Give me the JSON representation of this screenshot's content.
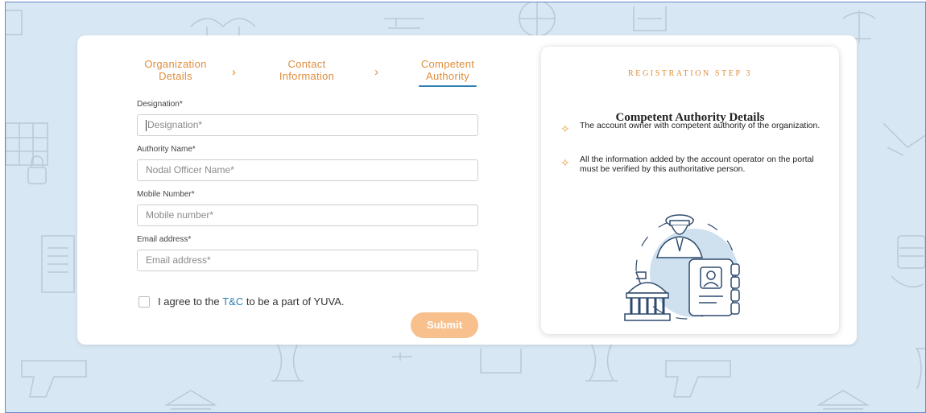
{
  "stepper": {
    "steps": [
      {
        "label_line1": "Organization",
        "label_line2": "Details"
      },
      {
        "label_line1": "Contact",
        "label_line2": "Information"
      },
      {
        "label_line1": "Competent",
        "label_line2": "Authority"
      }
    ],
    "chevron": "›",
    "active_step": 3
  },
  "form": {
    "designation": {
      "label": "Designation*",
      "placeholder": "Designation*"
    },
    "authority_name": {
      "label": "Authority Name*",
      "placeholder": "Nodal Officer Name*"
    },
    "mobile": {
      "label": "Mobile Number*",
      "placeholder": "Mobile number*"
    },
    "email": {
      "label": "Email address*",
      "placeholder": "Email address*"
    },
    "agree_prefix": "I agree to the ",
    "agree_link": "T&C",
    "agree_suffix": " to be a part of YUVA.",
    "submit_label": "Submit"
  },
  "panel": {
    "step_label": "REGISTRATION STEP 3",
    "title": "Competent Authority Details",
    "items": [
      "The account owner with competent authority of the organization.",
      "All the information added by the account operator on the portal must be verified by this authoritative person."
    ],
    "bullet_icon": "sparkle-icon"
  },
  "colors": {
    "accent_orange": "#e08d3c",
    "accent_blue": "#2d7fb3",
    "submit_bg": "#f7c08d",
    "page_bg": "#d7e7f3"
  }
}
